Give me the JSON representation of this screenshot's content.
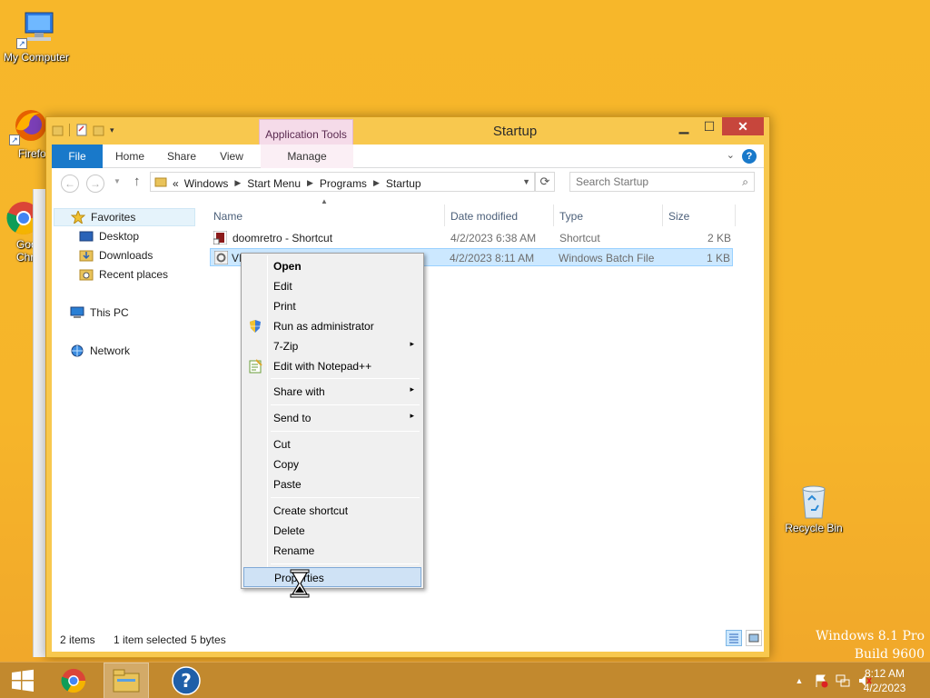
{
  "desktop": {
    "icons": [
      {
        "label": "My Computer"
      },
      {
        "label": "Firefo"
      },
      {
        "label": "Goo\nChr"
      },
      {
        "label": "Recycle Bin"
      }
    ],
    "watermark_line1": "Windows 8.1 Pro",
    "watermark_line2": "Build 9600"
  },
  "window": {
    "title": "Startup",
    "contextual_tab_group": "Application Tools",
    "tabs": [
      "File",
      "Home",
      "Share",
      "View",
      "Manage"
    ],
    "breadcrumb_prefix": "«",
    "breadcrumb": [
      "Windows",
      "Start Menu",
      "Programs",
      "Startup"
    ],
    "search_placeholder": "Search Startup",
    "nav": {
      "favorites": "Favorites",
      "desktop": "Desktop",
      "downloads": "Downloads",
      "recent": "Recent places",
      "this_pc": "This PC",
      "network": "Network"
    },
    "columns": [
      "Name",
      "Date modified",
      "Type",
      "Size"
    ],
    "files": [
      {
        "name": "doomretro - Shortcut",
        "date": "4/2/2023 6:38 AM",
        "type": "Shortcut",
        "size": "2 KB"
      },
      {
        "name": "VI",
        "date": "4/2/2023 8:11 AM",
        "type": "Windows Batch File",
        "size": "1 KB"
      }
    ],
    "status": {
      "items": "2 items",
      "selected": "1 item selected",
      "size": "5 bytes"
    }
  },
  "context_menu": {
    "items": [
      {
        "label": "Open",
        "bold": true
      },
      {
        "label": "Edit"
      },
      {
        "label": "Print"
      },
      {
        "label": "Run as administrator",
        "icon": "uac-shield-icon"
      },
      {
        "label": "7-Zip",
        "submenu": true
      },
      {
        "label": "Edit with Notepad++",
        "icon": "notepad-plus-plus-icon"
      },
      {
        "label": "Share with",
        "submenu": true
      },
      {
        "label": "Send to",
        "submenu": true
      },
      {
        "label": "Cut"
      },
      {
        "label": "Copy"
      },
      {
        "label": "Paste"
      },
      {
        "label": "Create shortcut"
      },
      {
        "label": "Delete"
      },
      {
        "label": "Rename"
      },
      {
        "label": "Properties",
        "hovered": true
      }
    ],
    "submenu_glyph": "▸"
  },
  "taskbar": {
    "clock_time": "8:12 AM",
    "clock_date": "4/2/2023",
    "tray_up_glyph": "▲"
  },
  "colors": {
    "desktop_bg": "#f6b52a",
    "window_frame": "#f8c84e",
    "file_tab": "#1979ca",
    "close_button": "#c7463c",
    "selection": "#cce8ff",
    "taskbar": "#c2892e"
  }
}
